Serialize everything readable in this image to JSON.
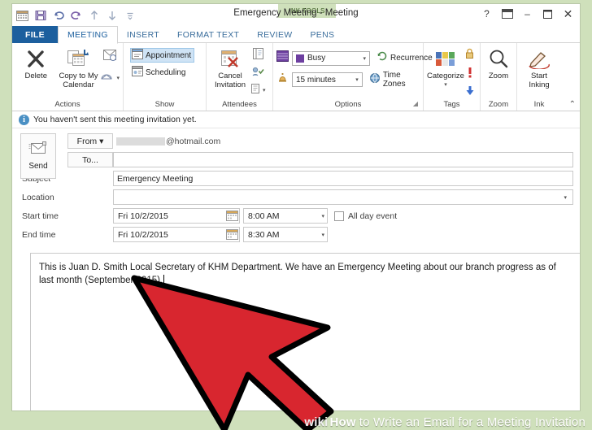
{
  "window": {
    "title": "Emergency Meeting - Meeting",
    "contextual_tab_label": "INK TOOLS",
    "help_label": "?",
    "ribbon_display_label": "❐",
    "minimize_label": "–",
    "restore_label": "❐",
    "close_label": "✕"
  },
  "quick_access": [
    {
      "name": "calendar-icon",
      "label": "Calendar"
    },
    {
      "name": "save-icon",
      "label": "Save"
    },
    {
      "name": "undo-icon",
      "label": "Undo"
    },
    {
      "name": "redo-icon",
      "label": "Redo"
    },
    {
      "name": "previous-item-icon",
      "label": "Previous Item"
    },
    {
      "name": "next-item-icon",
      "label": "Next Item"
    },
    {
      "name": "customize-qat-icon",
      "label": "Customize Quick Access Toolbar"
    }
  ],
  "tabs": [
    {
      "label": "FILE",
      "active": false,
      "file": true
    },
    {
      "label": "MEETING",
      "active": true,
      "file": false
    },
    {
      "label": "INSERT",
      "active": false,
      "file": false
    },
    {
      "label": "FORMAT TEXT",
      "active": false,
      "file": false
    },
    {
      "label": "REVIEW",
      "active": false,
      "file": false
    },
    {
      "label": "PENS",
      "active": false,
      "file": false
    }
  ],
  "ribbon": {
    "groups": [
      {
        "label": "Actions"
      },
      {
        "label": "Show"
      },
      {
        "label": "Attendees"
      },
      {
        "label": "Options"
      },
      {
        "label": "Tags"
      },
      {
        "label": "Zoom"
      },
      {
        "label": "Ink"
      }
    ],
    "actions": {
      "delete": "Delete",
      "copy_to_my_calendar": "Copy to My Calendar",
      "forward": "Forward"
    },
    "show": {
      "appointment": "Appointment",
      "scheduling": "Scheduling"
    },
    "attendees": {
      "cancel_invitation": "Cancel Invitation",
      "respond": "Respond"
    },
    "options": {
      "show_as_value": "Busy",
      "show_as_color": "#6d3fa0",
      "reminder_value": "15 minutes",
      "recurrence": "Recurrence",
      "time_zones": "Time Zones",
      "dialog_launcher": "◢"
    },
    "tags": {
      "categorize": "Categorize",
      "private": "Private",
      "high_importance": "High Importance",
      "low_importance": "Low Importance"
    },
    "zoom": {
      "zoom": "Zoom"
    },
    "ink": {
      "start_inking": "Start Inking"
    },
    "collapse_ribbon": "⌃"
  },
  "info_bar": {
    "icon": "info-icon",
    "text": "You haven't sent this meeting invitation yet."
  },
  "form": {
    "send_label": "Send",
    "from_label": "From ▾",
    "from_value_domain": "@hotmail.com",
    "to_label": "To...",
    "to_value": "",
    "subject_label": "Subject",
    "subject_value": "Emergency Meeting",
    "location_label": "Location",
    "location_value": "",
    "start_time_label": "Start time",
    "start_date_value": "Fri 10/2/2015",
    "start_time_value": "8:00 AM",
    "end_time_label": "End time",
    "end_date_value": "Fri 10/2/2015",
    "end_time_value": "8:30 AM",
    "all_day_label": "All day event",
    "all_day_checked": false
  },
  "body": {
    "text": "This is Juan D. Smith Local Secretary of KHM Department. We have an Emergency Meeting about our branch progress as of last month (September 2015),"
  },
  "watermark": {
    "logo": "wiki",
    "bold": "How",
    "rest": "to Write an Email for a Meeting Invitation"
  },
  "colors": {
    "file_tab": "#1c5f9e",
    "accent_blue": "#3b6e9c",
    "frame_green": "#cfe0bb",
    "selected_item": "#cfe3f5",
    "arrow_red": "#d8262f"
  }
}
